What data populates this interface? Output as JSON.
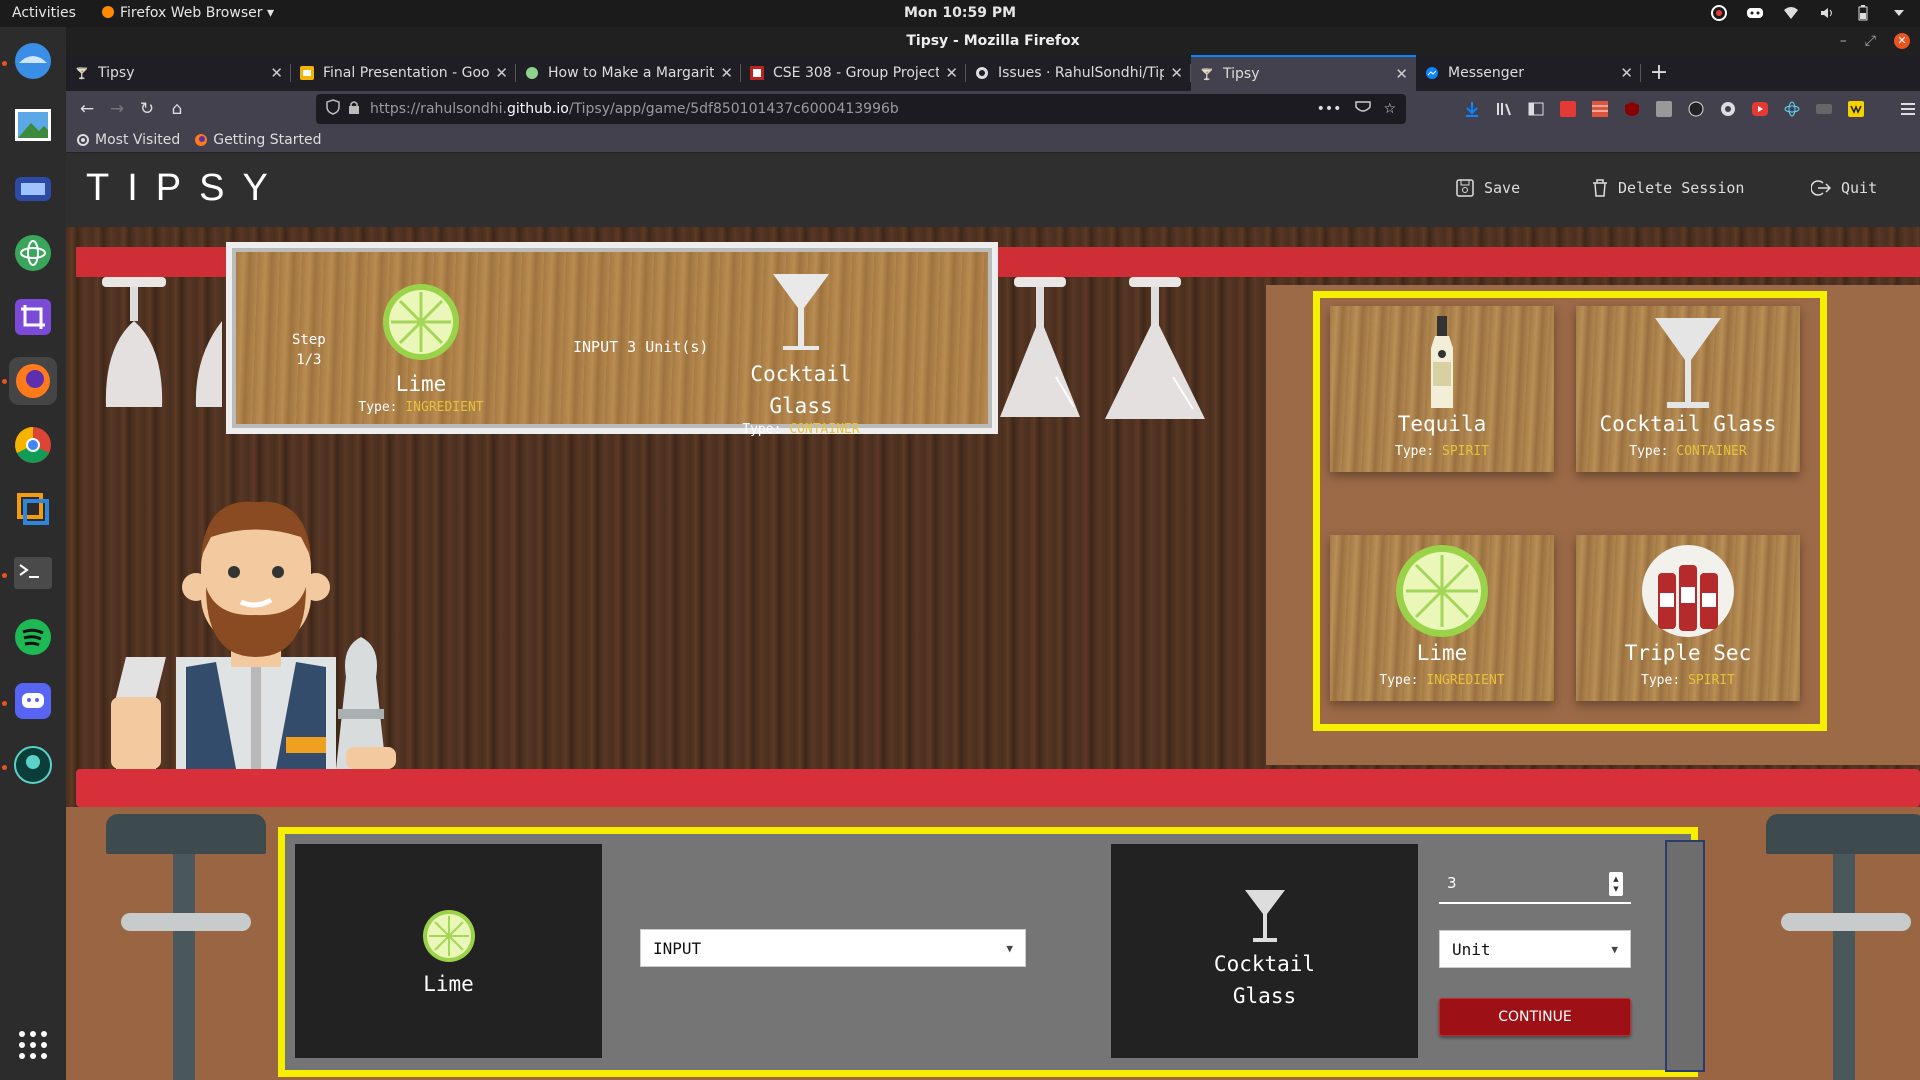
{
  "system": {
    "activities": "Activities",
    "app_menu": "Firefox Web Browser",
    "clock": "Mon 10:59 PM"
  },
  "window": {
    "title": "Tipsy - Mozilla Firefox"
  },
  "tabs": [
    {
      "label": "Tipsy",
      "icon": "tipsy-favicon"
    },
    {
      "label": "Final Presentation - Goo",
      "icon": "slides-favicon"
    },
    {
      "label": "How to Make a Margarita",
      "icon": "webpage-favicon"
    },
    {
      "label": "CSE 308 - Group Project",
      "icon": "doc-favicon"
    },
    {
      "label": "Issues · RahulSondhi/Tip",
      "icon": "github-favicon"
    },
    {
      "label": "Tipsy",
      "icon": "tipsy-favicon",
      "selected": true
    },
    {
      "label": "Messenger",
      "icon": "messenger-favicon"
    }
  ],
  "urlbar": {
    "prefix": "https://rahulsondhi.",
    "domain": "github.io",
    "path": "/Tipsy/app/game/5df850101437c6000413996b"
  },
  "bookmarks": [
    {
      "label": "Most Visited"
    },
    {
      "label": "Getting Started"
    }
  ],
  "app": {
    "logo": "TIPSY",
    "save": "Save",
    "delete_session": "Delete Session",
    "quit": "Quit"
  },
  "step": {
    "label": "Step",
    "progress": "1/3",
    "source": {
      "name": "Lime",
      "type_label": "Type:",
      "type": "INGREDIENT"
    },
    "action": "INPUT 3 Unit(s)",
    "target": {
      "name_line1": "Cocktail",
      "name_line2": "Glass",
      "type_label": "Type:",
      "type": "CONTAINER"
    }
  },
  "inventory": [
    {
      "name": "Tequila",
      "type_label": "Type:",
      "type": "SPIRIT",
      "icon": "tequila-bottle-icon"
    },
    {
      "name": "Cocktail Glass",
      "type_label": "Type:",
      "type": "CONTAINER",
      "icon": "cocktail-glass-icon"
    },
    {
      "name": "Lime",
      "type_label": "Type:",
      "type": "INGREDIENT",
      "icon": "lime-icon"
    },
    {
      "name": "Triple Sec",
      "type_label": "Type:",
      "type": "SPIRIT",
      "icon": "triple-sec-bottles-icon"
    }
  ],
  "mixer": {
    "source_name": "Lime",
    "action_value": "INPUT",
    "target_line1": "Cocktail",
    "target_line2": "Glass",
    "quantity": "3",
    "unit_value": "Unit",
    "continue_label": "CONTINUE"
  },
  "colors": {
    "accent_yellow": "#f5f000",
    "shelf_red": "#d8303a",
    "type_gold": "#e7c23a",
    "continue_red": "#9d1015"
  }
}
